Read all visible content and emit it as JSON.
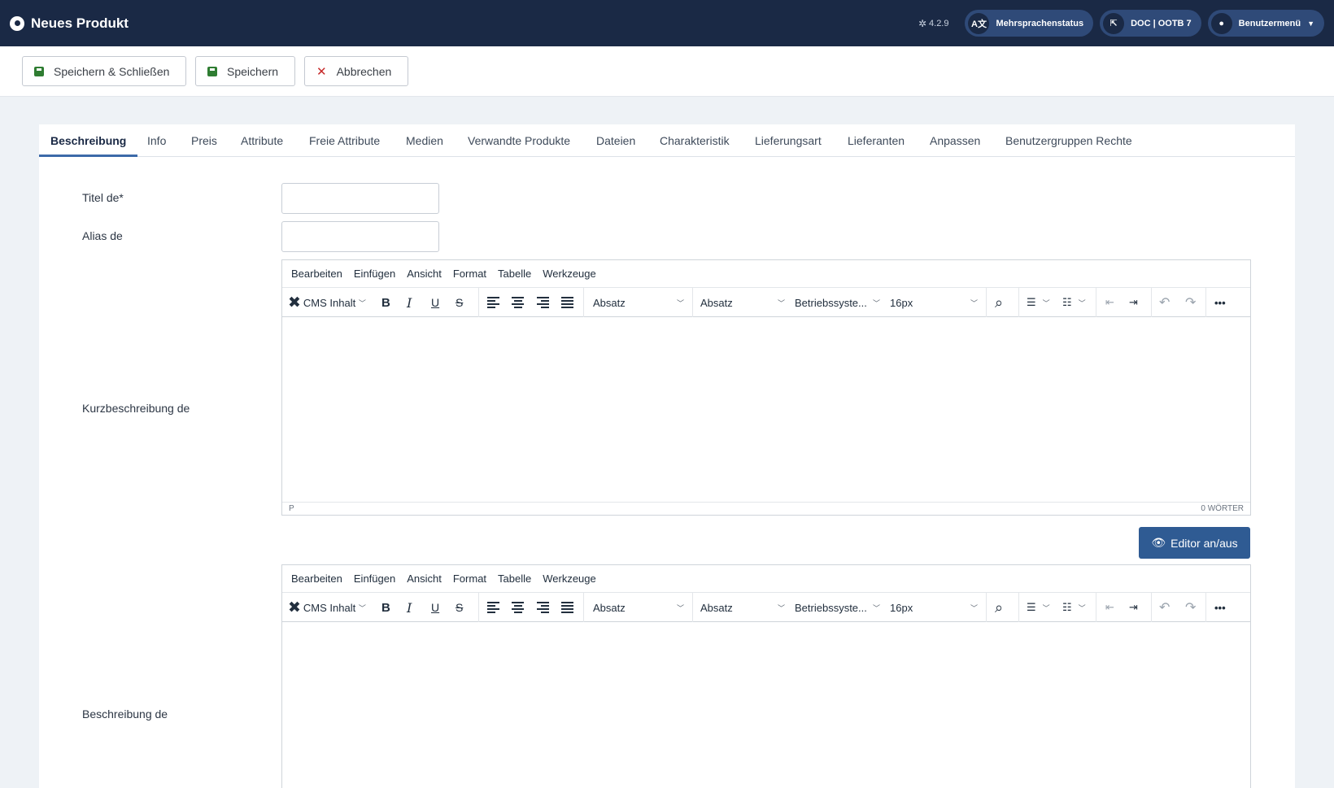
{
  "header": {
    "title": "Neues Produkt",
    "version": "4.2.9",
    "multilang_label": "Mehrsprachenstatus",
    "doc_label": "DOC | OOTB 7",
    "user_menu_label": "Benutzermenü"
  },
  "toolbar": {
    "save_close_label": "Speichern & Schließen",
    "save_label": "Speichern",
    "cancel_label": "Abbrechen"
  },
  "tabs": [
    "Beschreibung",
    "Info",
    "Preis",
    "Attribute",
    "Freie Attribute",
    "Medien",
    "Verwandte Produkte",
    "Dateien",
    "Charakteristik",
    "Lieferungsart",
    "Lieferanten",
    "Anpassen",
    "Benutzergruppen Rechte"
  ],
  "form": {
    "title_label": "Titel de*",
    "alias_label": "Alias de",
    "short_desc_label": "Kurzbeschreibung de",
    "desc_label": "Beschreibung de"
  },
  "editor": {
    "menu": [
      "Bearbeiten",
      "Einfügen",
      "Ansicht",
      "Format",
      "Tabelle",
      "Werkzeuge"
    ],
    "cms_label": "CMS Inhalt",
    "block_format": "Absatz",
    "style_format": "Absatz",
    "font_family": "Betriebssyste...",
    "font_size": "16px",
    "bold": "B",
    "italic": "I",
    "underline": "U",
    "strike": "S",
    "status_path": "P",
    "word_count": "0 WÖRTER"
  },
  "toggle_editor_label": "Editor an/aus"
}
